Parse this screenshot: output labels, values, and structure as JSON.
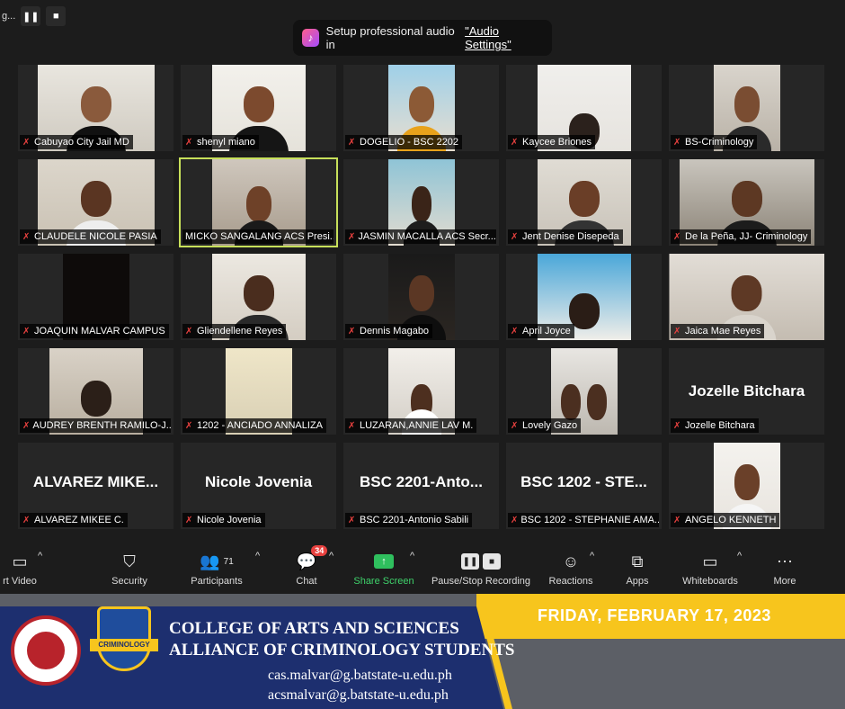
{
  "top": {
    "recording_label": "g...",
    "pause_glyph": "❚❚",
    "stop_glyph": "■"
  },
  "banner": {
    "text": "Setup professional audio in",
    "link": "\"Audio Settings\""
  },
  "participants": [
    {
      "name": "Cabuyao City Jail MD",
      "muted": true
    },
    {
      "name": "shenyl miano",
      "muted": true
    },
    {
      "name": "DOGELIO - BSC 2202",
      "muted": true
    },
    {
      "name": "Kaycee Briones",
      "muted": true
    },
    {
      "name": "BS-Criminology",
      "muted": true
    },
    {
      "name": "CLAUDELE NICOLE PASIA",
      "muted": true
    },
    {
      "name": "MICKO SANGALANG ACS Presi...",
      "muted": false
    },
    {
      "name": "JASMIN MACALLA ACS Secr...",
      "muted": true
    },
    {
      "name": "Jent Denise Disepeda",
      "muted": true
    },
    {
      "name": "De la Peña, JJ- Criminology",
      "muted": true
    },
    {
      "name": "JOAQUIN MALVAR CAMPUS",
      "muted": true
    },
    {
      "name": "Gliendellene Reyes",
      "muted": true
    },
    {
      "name": "Dennis Magabo",
      "muted": true
    },
    {
      "name": "April Joyce",
      "muted": true
    },
    {
      "name": "Jaica Mae Reyes",
      "muted": true
    },
    {
      "name": "AUDREY BRENTH RAMILO-J...",
      "muted": true
    },
    {
      "name": "1202 - ANCIADO ANNALIZA",
      "muted": true
    },
    {
      "name": "LUZARAN,ANNIE LAV M.",
      "muted": true
    },
    {
      "name": "Lovely Gazo",
      "muted": true
    },
    {
      "name": "Jozelle Bitchara",
      "muted": true,
      "display_name": "Jozelle Bitchara"
    },
    {
      "name": "ALVAREZ MIKEE C.",
      "muted": true,
      "display_name": "ALVAREZ  MIKE..."
    },
    {
      "name": "Nicole Jovenia",
      "muted": true,
      "display_name": "Nicole Jovenia"
    },
    {
      "name": "BSC 2201-Antonio Sabili",
      "muted": true,
      "display_name": "BSC  2201-Anto..."
    },
    {
      "name": "BSC 1202 - STEPHANIE AMA...",
      "muted": true,
      "display_name": "BSC  1202  -  STE..."
    },
    {
      "name": "ANGELO KENNETH",
      "muted": true
    }
  ],
  "toolbar": {
    "video_label": "rt Video",
    "security_label": "Security",
    "participants_label": "Participants",
    "participants_count": "71",
    "chat_label": "Chat",
    "chat_badge": "34",
    "share_label": "Share Screen",
    "record_label": "Pause/Stop Recording",
    "reactions_label": "Reactions",
    "apps_label": "Apps",
    "whiteboards_label": "Whiteboards",
    "more_label": "More"
  },
  "footer": {
    "date": "FRIDAY, FEBRUARY 17, 2023",
    "college": "COLLEGE OF ARTS AND SCIENCES",
    "alliance": "ALLIANCE OF CRIMINOLOGY STUDENTS",
    "email1": "cas.malvar@g.batstate-u.edu.ph",
    "email2": "acsmalvar@g.batstate-u.edu.ph",
    "seal2_ribbon": "CRIMINOLOGY"
  },
  "colors": {
    "active_speaker": "#c7e05a",
    "muted": "#e8413f",
    "share_green": "#2fbf5e",
    "banner_blue": "#1d2f6f",
    "banner_yellow": "#f7c51d"
  }
}
